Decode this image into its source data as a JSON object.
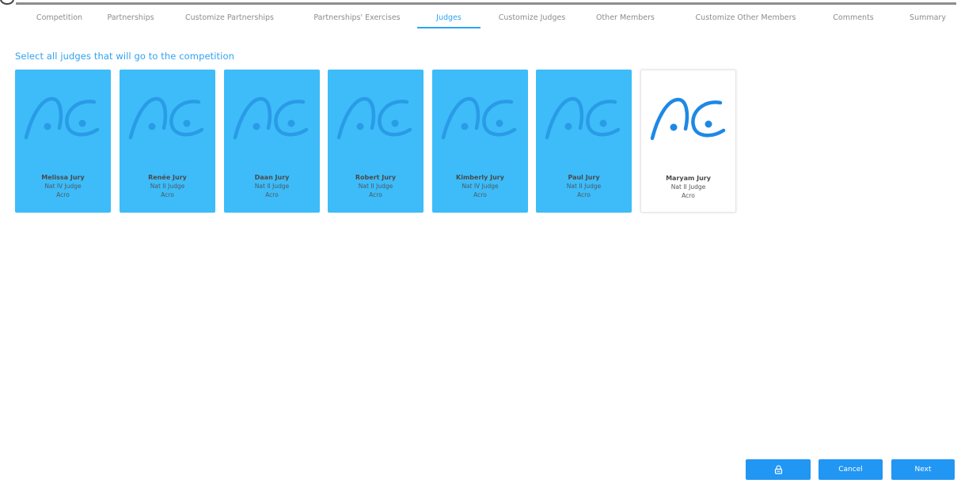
{
  "tabs": [
    {
      "label": "Competition",
      "active": false
    },
    {
      "label": "Partnerships",
      "active": false
    },
    {
      "label": "Customize Partnerships",
      "active": false
    },
    {
      "label": "Partnerships' Exercises",
      "active": false
    },
    {
      "label": "Judges",
      "active": true
    },
    {
      "label": "Customize Judges",
      "active": false
    },
    {
      "label": "Other Members",
      "active": false
    },
    {
      "label": "Customize Other Members",
      "active": false
    },
    {
      "label": "Comments",
      "active": false
    },
    {
      "label": "Summary",
      "active": false
    }
  ],
  "heading": "Select all judges that will go to the competition",
  "logo_icon": "ac-logo-icon",
  "judges": [
    {
      "name": "Melissa Jury",
      "level": "Nat IV Judge",
      "discipline": "Acro",
      "selected": true
    },
    {
      "name": "Renée Jury",
      "level": "Nat II Judge",
      "discipline": "Acro",
      "selected": true
    },
    {
      "name": "Daan Jury",
      "level": "Nat II Judge",
      "discipline": "Acro",
      "selected": true
    },
    {
      "name": "Robert Jury",
      "level": "Nat II Judge",
      "discipline": "Acro",
      "selected": true
    },
    {
      "name": "Kimberly Jury",
      "level": "Nat IV Judge",
      "discipline": "Acro",
      "selected": true
    },
    {
      "name": "Paul Jury",
      "level": "Nat II Judge",
      "discipline": "Acro",
      "selected": true
    },
    {
      "name": "Maryam Jury",
      "level": "Nat II Judge",
      "discipline": "Acro",
      "selected": false
    }
  ],
  "buttons": {
    "lock_icon": "lock-icon",
    "cancel_label": "Cancel",
    "next_label": "Next"
  },
  "colors": {
    "accent": "#2ea3f2",
    "card_selected": "#3dbcf9",
    "button": "#2196f3",
    "logo_on_selected": "#2a9be6",
    "logo_on_unselected": "#1e88e5"
  }
}
